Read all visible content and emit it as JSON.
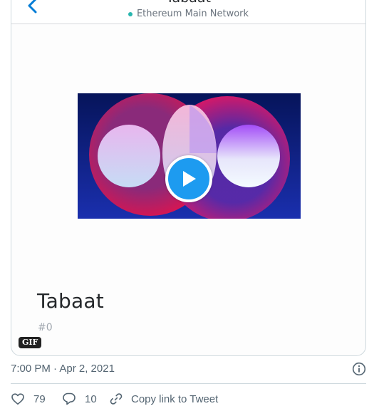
{
  "app_header": {
    "title": "Tabaat",
    "network": "Ethereum Main Network"
  },
  "nft": {
    "name": "Tabaat",
    "token_id": "#0"
  },
  "media_badge": "GIF",
  "tweet": {
    "timestamp": "7:00 PM · Apr 2, 2021",
    "like_count": "79",
    "reply_count": "10",
    "copy_link_label": "Copy link to Tweet"
  },
  "icons": {
    "back": "chevron-left-icon",
    "play": "play-icon",
    "info": "info-icon",
    "like": "heart-icon",
    "reply": "speech-bubble-icon",
    "copy_link": "link-icon"
  },
  "colors": {
    "accent_blue": "#1d9bf0",
    "network_dot": "#29b6af",
    "text_secondary": "#536471"
  }
}
